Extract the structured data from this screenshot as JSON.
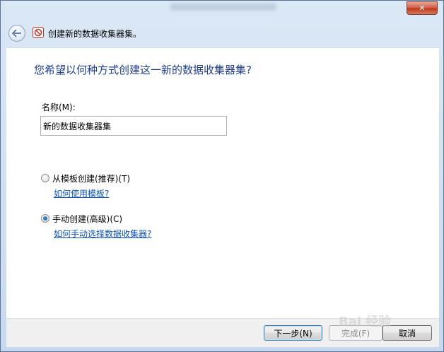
{
  "window": {
    "title": "",
    "close_symbol": "✕"
  },
  "nav": {
    "back_icon": "back-arrow-icon",
    "app_icon": "no-entry-icon",
    "dialog_title": "创建新的数据收集器集。"
  },
  "content": {
    "heading": "您希望以何种方式创建这一新的数据收集器集?",
    "name_label": "名称(M):",
    "name_value": "新的数据收集器集",
    "option_template": {
      "label": "从模板创建(推荐)(T)",
      "link": "如何使用模板?",
      "selected": false
    },
    "option_manual": {
      "label": "手动创建(高级)(C)",
      "link": "如何手动选择数据收集器?",
      "selected": true
    }
  },
  "footer": {
    "next_label": "下一步(N)",
    "finish_label": "完成(F)",
    "cancel_label": "取消"
  },
  "watermark": "Bai 经验"
}
